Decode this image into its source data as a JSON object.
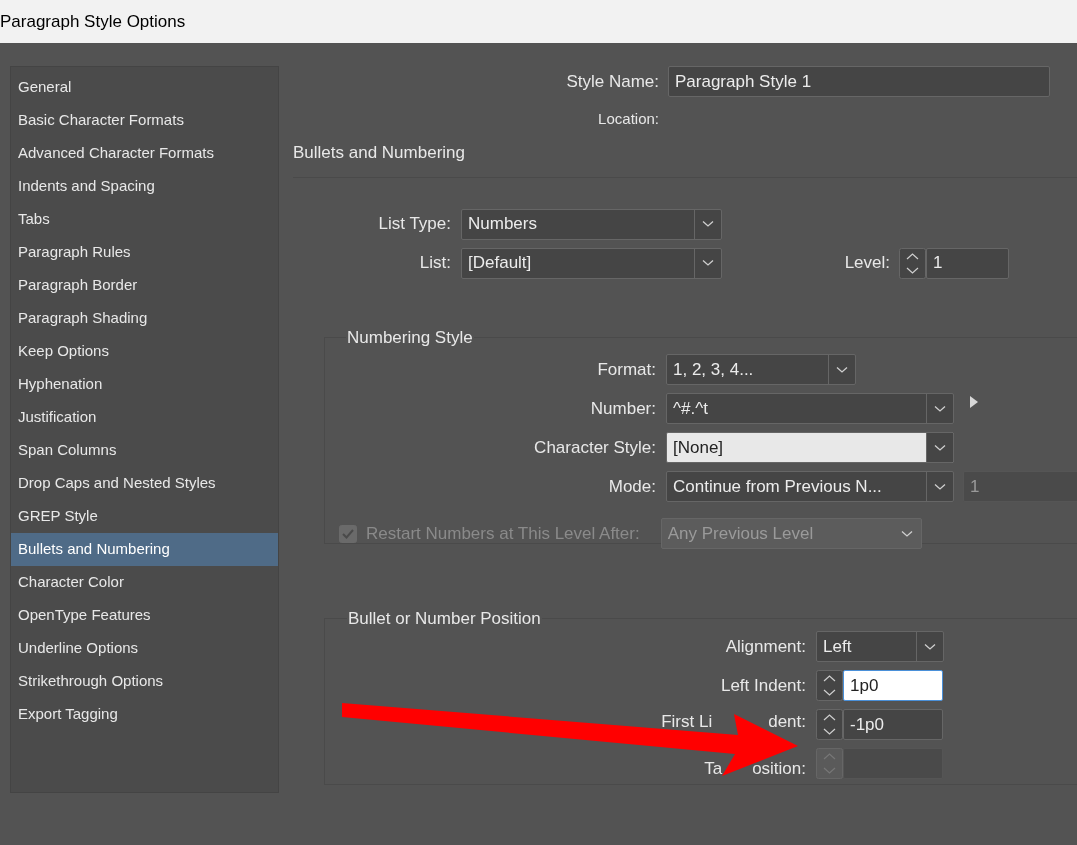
{
  "window": {
    "title": "Paragraph Style Options"
  },
  "sidebar": {
    "items": [
      {
        "label": "General",
        "selected": false
      },
      {
        "label": "Basic Character Formats",
        "selected": false
      },
      {
        "label": "Advanced Character Formats",
        "selected": false
      },
      {
        "label": "Indents and Spacing",
        "selected": false
      },
      {
        "label": "Tabs",
        "selected": false
      },
      {
        "label": "Paragraph Rules",
        "selected": false
      },
      {
        "label": "Paragraph Border",
        "selected": false
      },
      {
        "label": "Paragraph Shading",
        "selected": false
      },
      {
        "label": "Keep Options",
        "selected": false
      },
      {
        "label": "Hyphenation",
        "selected": false
      },
      {
        "label": "Justification",
        "selected": false
      },
      {
        "label": "Span Columns",
        "selected": false
      },
      {
        "label": "Drop Caps and Nested Styles",
        "selected": false
      },
      {
        "label": "GREP Style",
        "selected": false
      },
      {
        "label": "Bullets and Numbering",
        "selected": true
      },
      {
        "label": "Character Color",
        "selected": false
      },
      {
        "label": "OpenType Features",
        "selected": false
      },
      {
        "label": "Underline Options",
        "selected": false
      },
      {
        "label": "Strikethrough Options",
        "selected": false
      },
      {
        "label": "Export Tagging",
        "selected": false
      }
    ]
  },
  "style_name": {
    "label": "Style Name:",
    "value": "Paragraph Style 1"
  },
  "location": {
    "label": "Location:"
  },
  "section_title": "Bullets and Numbering",
  "list_type": {
    "label": "List Type:",
    "value": "Numbers"
  },
  "list": {
    "label": "List:",
    "value": "[Default]"
  },
  "level": {
    "label": "Level:",
    "value": "1"
  },
  "numbering_style": {
    "title": "Numbering Style",
    "format": {
      "label": "Format:",
      "value": "1, 2, 3, 4..."
    },
    "number": {
      "label": "Number:",
      "value": "^#.^t"
    },
    "character_style": {
      "label": "Character Style:",
      "value": "[None]"
    },
    "mode": {
      "label": "Mode:",
      "value": "Continue from Previous N...",
      "start_value": "1",
      "start_disabled": true
    },
    "restart": {
      "label": "Restart Numbers at This Level After:",
      "checked": true,
      "disabled": true,
      "value": "Any Previous Level"
    }
  },
  "position": {
    "title": "Bullet or Number Position",
    "rows": [
      {
        "kind": "select",
        "label": "Alignment:",
        "value": "Left",
        "disabled": false,
        "focused": false
      },
      {
        "kind": "spinner",
        "label": "Left Indent:",
        "value": "1p0",
        "disabled": false,
        "focused": true
      },
      {
        "kind": "spinner",
        "label_parts": [
          "First Li",
          "dent:"
        ],
        "value": "-1p0",
        "disabled": false,
        "focused": false
      },
      {
        "kind": "spinner",
        "label_parts": [
          "Ta",
          "osition:"
        ],
        "disabled": true,
        "focused": false
      }
    ]
  },
  "annotation": {
    "kind": "arrow"
  }
}
